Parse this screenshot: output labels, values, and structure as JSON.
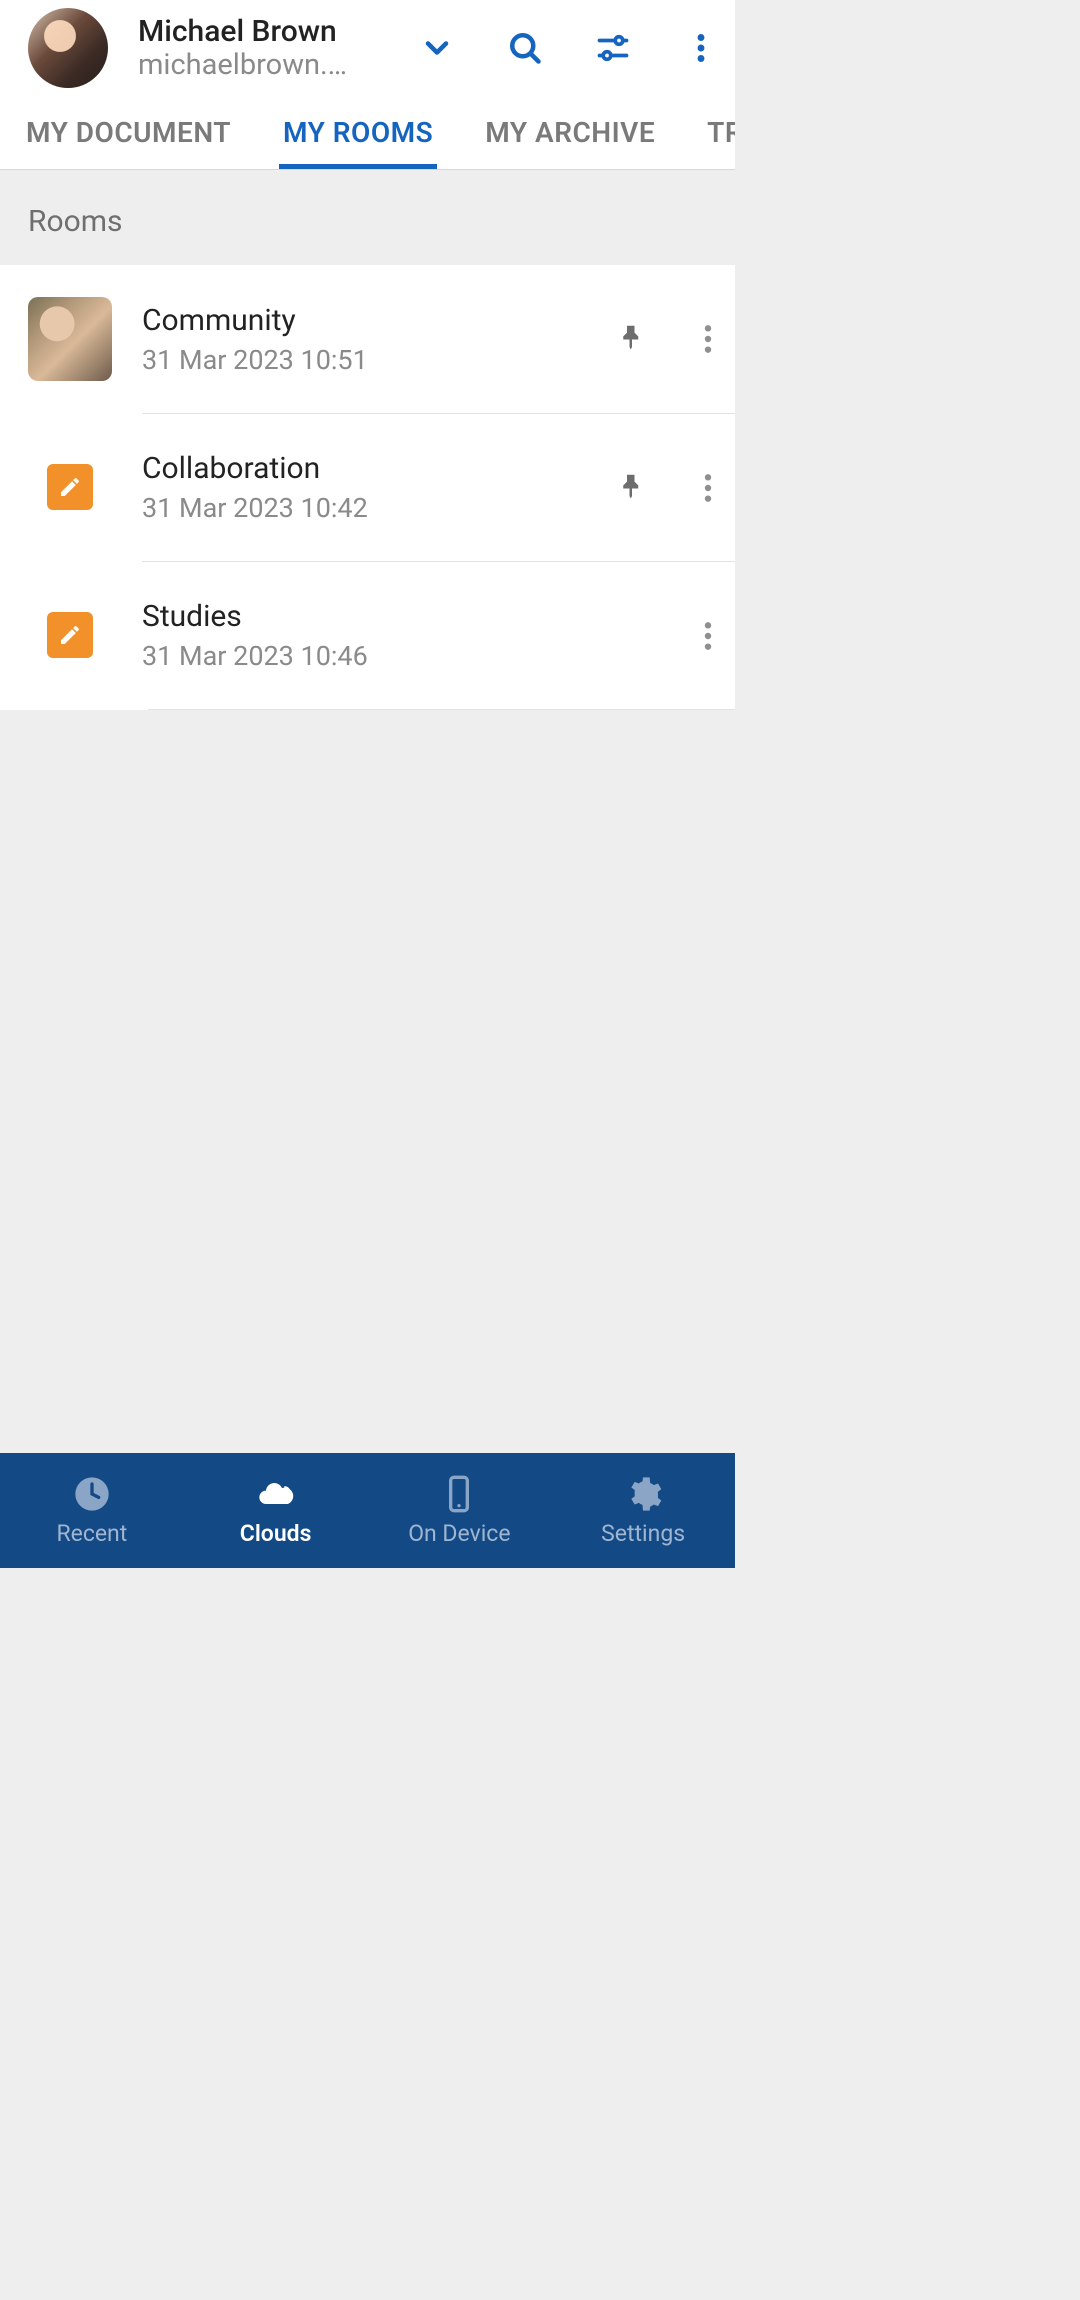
{
  "header": {
    "user_name": "Michael Brown",
    "user_mail": "michaelbrown.o…"
  },
  "tabs": [
    {
      "label": "MY DOCUMENT",
      "active": false
    },
    {
      "label": "MY ROOMS",
      "active": true
    },
    {
      "label": "MY ARCHIVE",
      "active": false
    },
    {
      "label": "TRASH",
      "active": false
    }
  ],
  "section_title": "Rooms",
  "rooms": [
    {
      "title": "Community",
      "date": "31 Mar 2023 10:51",
      "pinned": true,
      "icon": "photo"
    },
    {
      "title": "Collaboration",
      "date": "31 Mar 2023 10:42",
      "pinned": true,
      "icon": "edit"
    },
    {
      "title": "Studies",
      "date": "31 Mar 2023 10:46",
      "pinned": false,
      "icon": "edit"
    }
  ],
  "bottom_nav": [
    {
      "label": "Recent",
      "icon": "clock",
      "active": false
    },
    {
      "label": "Clouds",
      "icon": "cloud",
      "active": true
    },
    {
      "label": "On Device",
      "icon": "device",
      "active": false
    },
    {
      "label": "Settings",
      "icon": "gear",
      "active": false
    }
  ]
}
